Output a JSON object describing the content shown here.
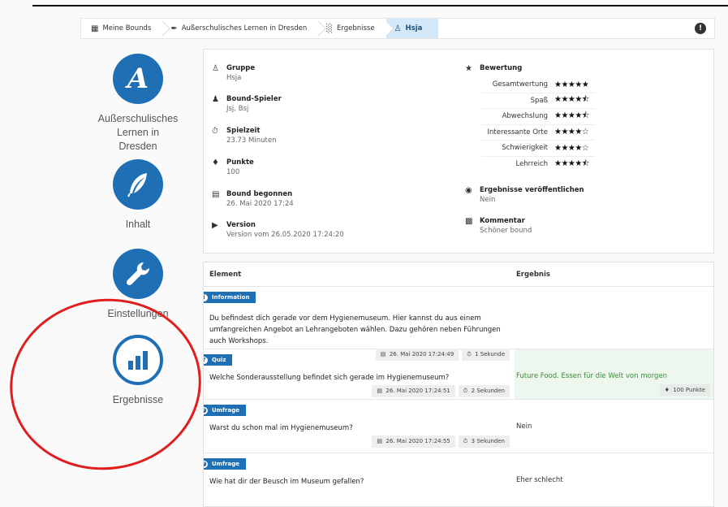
{
  "breadcrumb": {
    "items": [
      {
        "label": "Meine Bounds",
        "icon": "grid-icon"
      },
      {
        "label": "Außerschulisches Lernen in Dresden",
        "icon": "feather-icon"
      },
      {
        "label": "Ergebnisse",
        "icon": "bar-chart-icon"
      },
      {
        "label": "Hsja",
        "icon": "group-icon",
        "active": true
      }
    ],
    "info": "!"
  },
  "sidebar": {
    "items": [
      {
        "label": "Außerschulisches Lernen in Dresden",
        "logo_letter": "A",
        "icon": "logo-a-icon"
      },
      {
        "label": "Inhalt",
        "icon": "feather-icon"
      },
      {
        "label": "Einstellungen",
        "icon": "wrench-icon"
      },
      {
        "label": "Ergebnisse",
        "icon": "bar-chart-icon"
      }
    ]
  },
  "details": {
    "gruppe": {
      "title": "Gruppe",
      "value": "Hsja"
    },
    "spieler": {
      "title": "Bound-Spieler",
      "value": "Jsj, Bsj"
    },
    "spielzeit": {
      "title": "Spielzeit",
      "value": "23.73 Minuten"
    },
    "punkte": {
      "title": "Punkte",
      "value": "100"
    },
    "begonnen": {
      "title": "Bound begonnen",
      "value": "26. Mai 2020 17:24"
    },
    "version": {
      "title": "Version",
      "value": "Version vom 26.05.2020 17:24:20"
    },
    "bewertung": {
      "title": "Bewertung",
      "rows": [
        {
          "label": "Gesamtwertung",
          "stars": "★★★★★",
          "value": 5
        },
        {
          "label": "Spaß",
          "stars": "★★★★⯪",
          "value": 4.5
        },
        {
          "label": "Abwechslung",
          "stars": "★★★★⯪",
          "value": 4.5
        },
        {
          "label": "Interessante Orte",
          "stars": "★★★★☆",
          "value": 4
        },
        {
          "label": "Schwierigkeit",
          "stars": "★★★★☆",
          "value": 4
        },
        {
          "label": "Lehrreich",
          "stars": "★★★★⯪",
          "value": 4.5
        }
      ]
    },
    "veroeffentlichen": {
      "title": "Ergebnisse veröffentlichen",
      "value": "Nein"
    },
    "kommentar": {
      "title": "Kommentar",
      "value": "Schöner bound"
    }
  },
  "results": {
    "col_element": "Element",
    "col_ergebnis": "Ergebnis",
    "rows": [
      {
        "type": "Information",
        "text": "Du befindest dich gerade vor dem Hygienemuseum. Hier kannst du aus einem umfangreichen Angebot an Lehrangeboten wählen. Dazu gehören neben Führungen auch Workshops.",
        "time": "26. Mai 2020 17:24:49",
        "duration": "1 Sekunde",
        "result": "",
        "points": ""
      },
      {
        "type": "Quiz",
        "text": "Welche Sonderausstellung befindet sich gerade im Hygienemuseum?",
        "time": "26. Mai 2020 17:24:51",
        "duration": "2 Sekunden",
        "result": "Future Food. Essen für die Welt von morgen",
        "points": "100 Punkte"
      },
      {
        "type": "Umfrage",
        "text": "Warst du schon mal im Hygienemuseum?",
        "time": "26. Mai 2020 17:24:55",
        "duration": "3 Sekunden",
        "result": "Nein",
        "points": ""
      },
      {
        "type": "Umfrage",
        "text": "Wie hat dir der Beusch im Museum gefallen?",
        "time": "",
        "duration": "",
        "result": "Eher schlecht",
        "points": ""
      }
    ]
  },
  "colors": {
    "primary": "#1f6fb5",
    "annotation": "#e01e1e",
    "correct_bg": "#eef7ee"
  }
}
